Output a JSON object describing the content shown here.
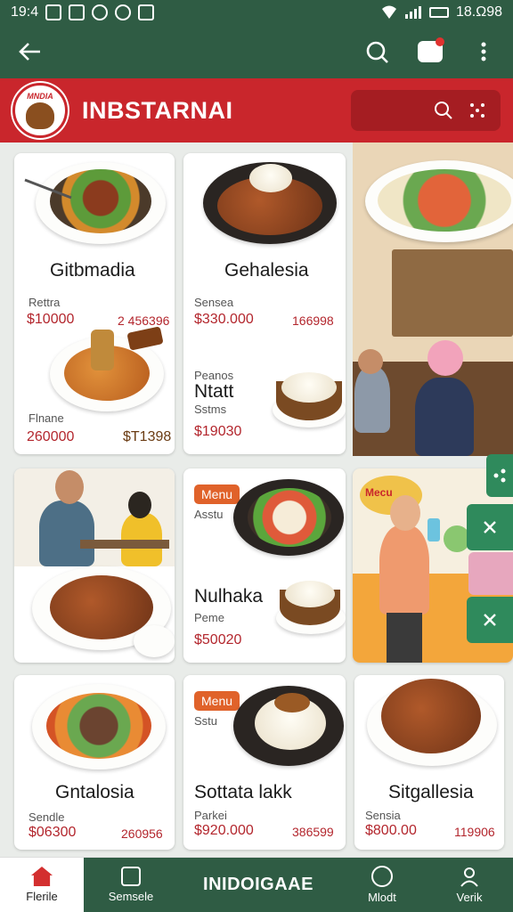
{
  "status_bar": {
    "time": "19:4",
    "right_text": "18.Ω98"
  },
  "app_bar": {
    "back_icon": "arrow-left-icon",
    "search_icon": "search-icon",
    "chat_icon": "chat-icon",
    "more_icon": "more-vert-icon"
  },
  "brand": {
    "logo_text": "MNDIA",
    "name": "INBSTARNAI"
  },
  "colors": {
    "primary_green": "#2f5c44",
    "brand_red": "#c9262c",
    "price_red": "#b3262d"
  },
  "cards": {
    "c1": {
      "title": "Gitbmadia",
      "sub": "Rettra",
      "price": "$10000",
      "price2": "2 456396"
    },
    "c1b": {
      "sub": "Flnane",
      "price": "260000",
      "price2": "$T1398"
    },
    "c2": {
      "title": "Gehalesia",
      "sub": "Sensea",
      "price": "$330.000",
      "price2": "166998"
    },
    "c2b": {
      "line1": "Peanos",
      "title": "Ntatt",
      "sub": "Sstms",
      "price": "$19030"
    },
    "c5": {
      "badge": "Menu",
      "sub_top": "Asstu",
      "title": "Nulhaka",
      "sub": "Peme",
      "price": "$50020"
    },
    "c6": {
      "badge": "Menu",
      "text": "Mecu"
    },
    "c7": {
      "title": "Gntalosia",
      "sub": "Sendle",
      "price": "$06300",
      "price2": "260956"
    },
    "c8": {
      "badge": "Menu",
      "sub_top": "Sstu",
      "title": "Sottata lakk",
      "sub": "Parkei",
      "price": "$920.000",
      "price2": "386599"
    },
    "c9": {
      "title": "Sitgallesia",
      "sub": "Sensia",
      "price": "$800.00",
      "price2": "119906"
    }
  },
  "bottom_nav": {
    "home": "Flerile",
    "second": "Semsele",
    "center": "INIDOIGAAE",
    "fourth": "Mlodt",
    "fifth": "Verik"
  }
}
